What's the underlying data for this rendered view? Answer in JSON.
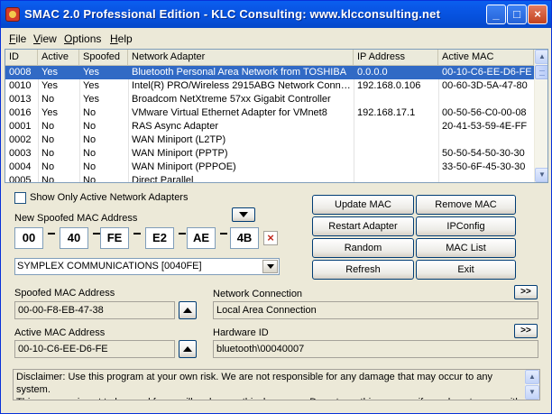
{
  "window": {
    "title": "SMAC 2.0  Professional Edition  -  KLC Consulting:  www.klcconsulting.net",
    "minimize_glyph": "_",
    "maximize_glyph": "□",
    "close_glyph": "×",
    "app_icon": "smac-app-icon",
    "title_color": "#0A58E8"
  },
  "menu": [
    {
      "key": "F",
      "rest": "ile"
    },
    {
      "key": "V",
      "rest": "iew"
    },
    {
      "key": "O",
      "rest": "ptions"
    },
    {
      "key": "H",
      "rest": "elp"
    }
  ],
  "table": {
    "columns": [
      "ID",
      "Active",
      "Spoofed",
      "Network Adapter",
      "IP Address",
      "Active MAC"
    ],
    "rows": [
      [
        "0008",
        "Yes",
        "Yes",
        "Bluetooth Personal Area Network from TOSHIBA",
        "0.0.0.0",
        "00-10-C6-EE-D6-FE"
      ],
      [
        "0010",
        "Yes",
        "Yes",
        "Intel(R) PRO/Wireless 2915ABG Network Conne...",
        "192.168.0.106",
        "00-60-3D-5A-47-80"
      ],
      [
        "0013",
        "No",
        "Yes",
        "Broadcom NetXtreme 57xx Gigabit Controller",
        "",
        ""
      ],
      [
        "0016",
        "Yes",
        "No",
        "VMware Virtual Ethernet Adapter for VMnet8",
        "192.168.17.1",
        "00-50-56-C0-00-08"
      ],
      [
        "0001",
        "No",
        "No",
        "RAS Async Adapter",
        "",
        "20-41-53-59-4E-FF"
      ],
      [
        "0002",
        "No",
        "No",
        "WAN Miniport (L2TP)",
        "",
        ""
      ],
      [
        "0003",
        "No",
        "No",
        "WAN Miniport (PPTP)",
        "",
        "50-50-54-50-30-30"
      ],
      [
        "0004",
        "No",
        "No",
        "WAN Miniport (PPPOE)",
        "",
        "33-50-6F-45-30-30"
      ],
      [
        "0005",
        "No",
        "No",
        "Direct Parallel",
        "",
        ""
      ]
    ],
    "selected_row": 0,
    "selection_color": "#316AC5"
  },
  "controls": {
    "show_only_active": {
      "label": "Show Only Active Network Adapters",
      "checked": false
    },
    "new_mac_label": "New Spoofed MAC Address",
    "new_mac": [
      "00",
      "40",
      "FE",
      "E2",
      "AE",
      "4B"
    ],
    "clear_glyph": "×",
    "vendor": "SYMPLEX COMMUNICATIONS [0040FE]",
    "spoofed_mac_label": "Spoofed MAC Address",
    "spoofed_mac": "00-00-F8-EB-47-38",
    "active_mac_label": "Active MAC Address",
    "active_mac": "00-10-C6-EE-D6-FE",
    "network_connection_label": "Network Connection",
    "network_connection": "Local Area Connection",
    "hardware_id_label": "Hardware ID",
    "hardware_id": "bluetooth\\00040007",
    "more_glyph": ">>"
  },
  "buttons": {
    "update_mac": "Update MAC",
    "remove_mac": "Remove MAC",
    "restart_adapter": "Restart Adapter",
    "ipconfig": "IPConfig",
    "random": "Random",
    "mac_list": "MAC List",
    "refresh": "Refresh",
    "exit": "Exit"
  },
  "disclaimer": "Disclaimer: Use this program at your own risk.  We are not responsible for any damage that may occur to any system.\nThis program is not to be used for any illegal or unethical purpose.  Do not use this program if you do not agree with",
  "scroll": {
    "up_glyph": "▲",
    "down_glyph": "▼"
  }
}
